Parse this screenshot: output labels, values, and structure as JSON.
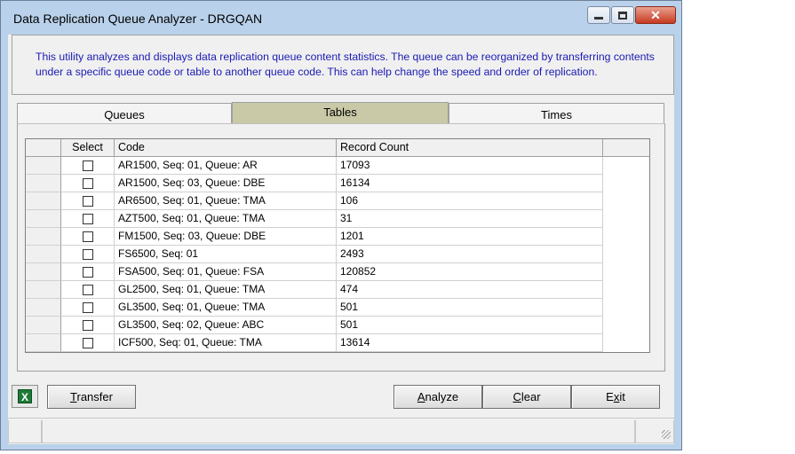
{
  "window": {
    "title": "Data Replication Queue Analyzer - DRGQAN"
  },
  "info": {
    "text": "This utility analyzes and displays data replication queue content statistics. The queue can be reorganized by transferring contents under a specific queue code or table to another queue code. This can help change the speed and order of replication."
  },
  "tabs": [
    {
      "label": "Queues"
    },
    {
      "label": "Tables"
    },
    {
      "label": "Times"
    }
  ],
  "grid": {
    "headers": {
      "select": "Select",
      "code": "Code",
      "count": "Record Count"
    },
    "rows": [
      {
        "code": "AR1500, Seq: 01, Queue: AR",
        "count": "17093"
      },
      {
        "code": "AR1500, Seq: 03, Queue: DBE",
        "count": "16134"
      },
      {
        "code": "AR6500, Seq: 01, Queue: TMA",
        "count": "106"
      },
      {
        "code": "AZT500, Seq: 01, Queue: TMA",
        "count": "31"
      },
      {
        "code": "FM1500, Seq: 03, Queue: DBE",
        "count": "1201"
      },
      {
        "code": "FS6500, Seq: 01",
        "count": "2493"
      },
      {
        "code": "FSA500, Seq: 01, Queue: FSA",
        "count": "120852"
      },
      {
        "code": "GL2500, Seq: 01, Queue: TMA",
        "count": "474"
      },
      {
        "code": "GL3500, Seq: 01, Queue: TMA",
        "count": "501"
      },
      {
        "code": "GL3500, Seq: 02, Queue: ABC",
        "count": "501"
      },
      {
        "code": "ICF500, Seq: 01, Queue: TMA",
        "count": "13614"
      }
    ]
  },
  "buttons": {
    "transfer_prefix": "",
    "transfer_mnemonic": "T",
    "transfer_rest": "ransfer",
    "analyze_prefix": "",
    "analyze_mnemonic": "A",
    "analyze_rest": "nalyze",
    "clear_prefix": "",
    "clear_mnemonic": "C",
    "clear_rest": "lear",
    "exit_prefix": "E",
    "exit_mnemonic": "x",
    "exit_rest": "it"
  },
  "icons": {
    "excel": "excel-export-icon",
    "excel_glyph": "X"
  },
  "colors": {
    "info_text": "#1a1ab4",
    "active_tab": "#c9c9a8",
    "window_frame": "#b9d1ea"
  }
}
